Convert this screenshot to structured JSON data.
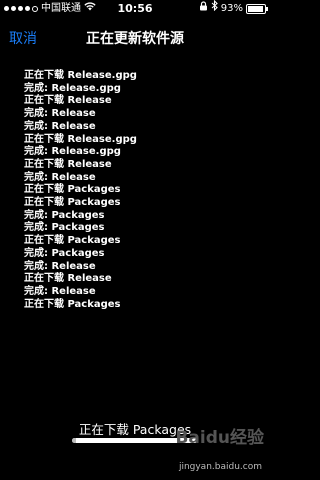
{
  "statusbar": {
    "carrier": "中国联通",
    "time": "10:56",
    "battery_text": "93%",
    "battery_level": 0.93
  },
  "navbar": {
    "cancel_label": "取消",
    "title": "正在更新软件源"
  },
  "log_lines": [
    "正在下载 Release.gpg",
    "完成: Release.gpg",
    "正在下载 Release",
    "完成: Release",
    "完成: Release",
    "正在下载 Release.gpg",
    "完成: Release.gpg",
    "正在下载 Release",
    "完成: Release",
    "正在下载 Packages",
    "正在下载 Packages",
    "完成: Packages",
    "完成: Packages",
    "正在下载 Packages",
    "完成: Packages",
    "完成: Release",
    "正在下载 Release",
    "完成: Release",
    "正在下载 Packages"
  ],
  "progress": {
    "label": "正在下载 Packages",
    "fraction": 0.03
  },
  "watermark": {
    "text": "Baidu经验",
    "url": "jingyan.baidu.com"
  },
  "colors": {
    "accent": "#1a7cf4",
    "background": "#000000",
    "text": "#ffffff"
  }
}
